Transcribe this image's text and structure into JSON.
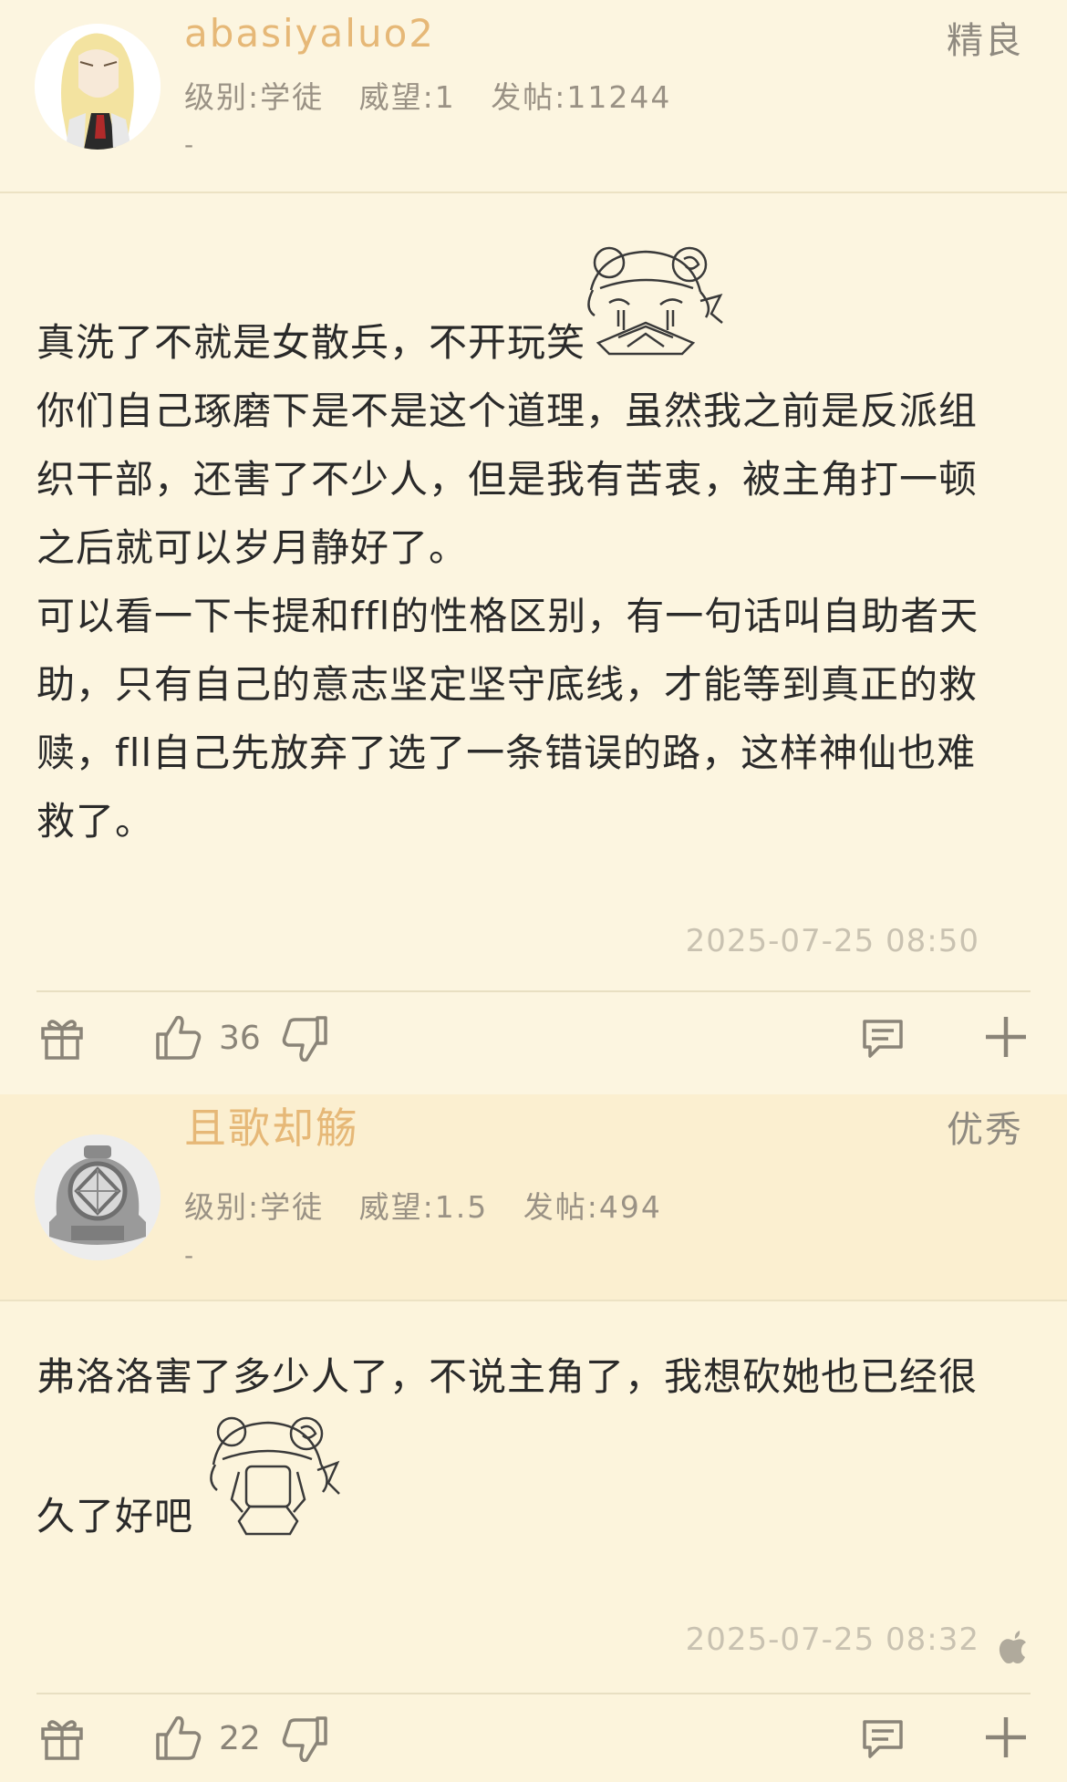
{
  "posts": [
    {
      "username": "abasiyaluo2",
      "level": "级别:学徒",
      "prestige": "威望:1",
      "post_count": "发帖:11244",
      "signature": "-",
      "rating": "精良",
      "content_lines": [
        "真洗了不就是女散兵，不开玩笑",
        "你们自己琢磨下是不是这个道理，虽然我之前是反派组",
        "织干部，还害了不少人，但是我有苦衷，被主角打一顿",
        "之后就可以岁月静好了。",
        "可以看一下卡提和ffl的性格区别，有一句话叫自助者天",
        "助，只有自己的意志坚定坚守底线，才能等到真正的救",
        "赎，fll自己先放弃了选了一条错误的路，这样神仙也难",
        "救了。"
      ],
      "timestamp": "2025-07-25 08:50",
      "likes": "36",
      "icons": [
        "gift-icon",
        "thumbs-up-icon",
        "thumbs-down-icon",
        "reply-icon",
        "plus-icon"
      ]
    },
    {
      "username": "且歌却觞",
      "level": "级别:学徒",
      "prestige": "威望:1.5",
      "post_count": "发帖:494",
      "signature": "-",
      "rating": "优秀",
      "content_lines": [
        "弗洛洛害了多少人了，不说主角了，我想砍她也已经很",
        "久了好吧"
      ],
      "timestamp": "2025-07-25 08:32",
      "likes": "22",
      "icons": [
        "gift-icon",
        "thumbs-up-icon",
        "thumbs-down-icon",
        "reply-icon",
        "plus-icon",
        "apple-icon"
      ]
    }
  ],
  "colors": {
    "background": "#fcf6e1",
    "username": "#e6b877",
    "meta_text": "#9a9285",
    "timestamp": "#c9c2b1",
    "icon": "#8a8478"
  }
}
